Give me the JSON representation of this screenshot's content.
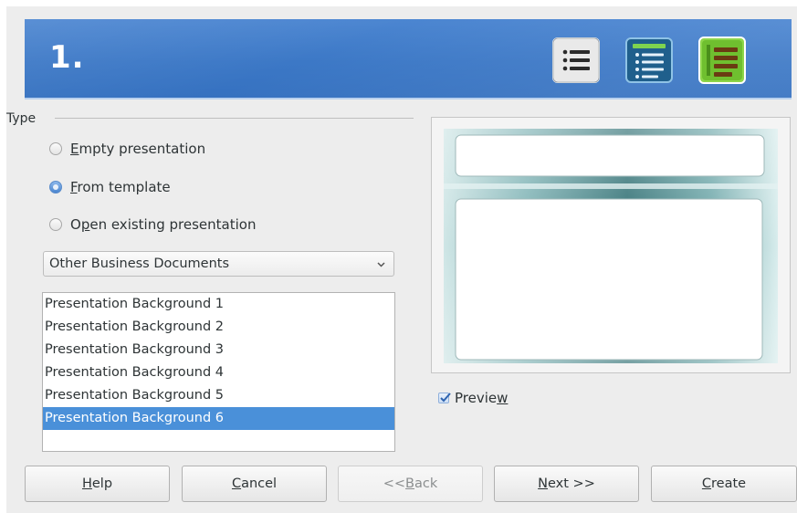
{
  "header": {
    "step": "1."
  },
  "type_section": {
    "legend": "Type",
    "radios": [
      {
        "pre": "",
        "mn": "E",
        "post": "mpty presentation",
        "checked": false
      },
      {
        "pre": "",
        "mn": "F",
        "post": "rom template",
        "checked": true
      },
      {
        "pre": "O",
        "mn": "p",
        "post": "en existing presentation",
        "checked": false
      }
    ],
    "category_select": "Other Business Documents",
    "templates": [
      "Presentation Background 1",
      "Presentation Background 2",
      "Presentation Background 3",
      "Presentation Background 4",
      "Presentation Background 5",
      "Presentation Background 6"
    ],
    "selected_template": "Presentation Background 6"
  },
  "preview": {
    "checkbox_pre": "Previe",
    "checkbox_mn": "w",
    "checked": true
  },
  "buttons": {
    "help": {
      "pre": "",
      "mn": "H",
      "post": "elp"
    },
    "cancel": {
      "pre": "",
      "mn": "C",
      "post": "ancel"
    },
    "back": {
      "pre": "<< ",
      "mn": "B",
      "post": "ack"
    },
    "next": {
      "pre": "",
      "mn": "N",
      "post": "ext >>"
    },
    "create": {
      "pre": "",
      "mn": "C",
      "post": "reate"
    }
  },
  "colors": {
    "banner": "#3c78c6",
    "selection": "#4a90d9",
    "step3_icon": "#6fbf2f"
  }
}
